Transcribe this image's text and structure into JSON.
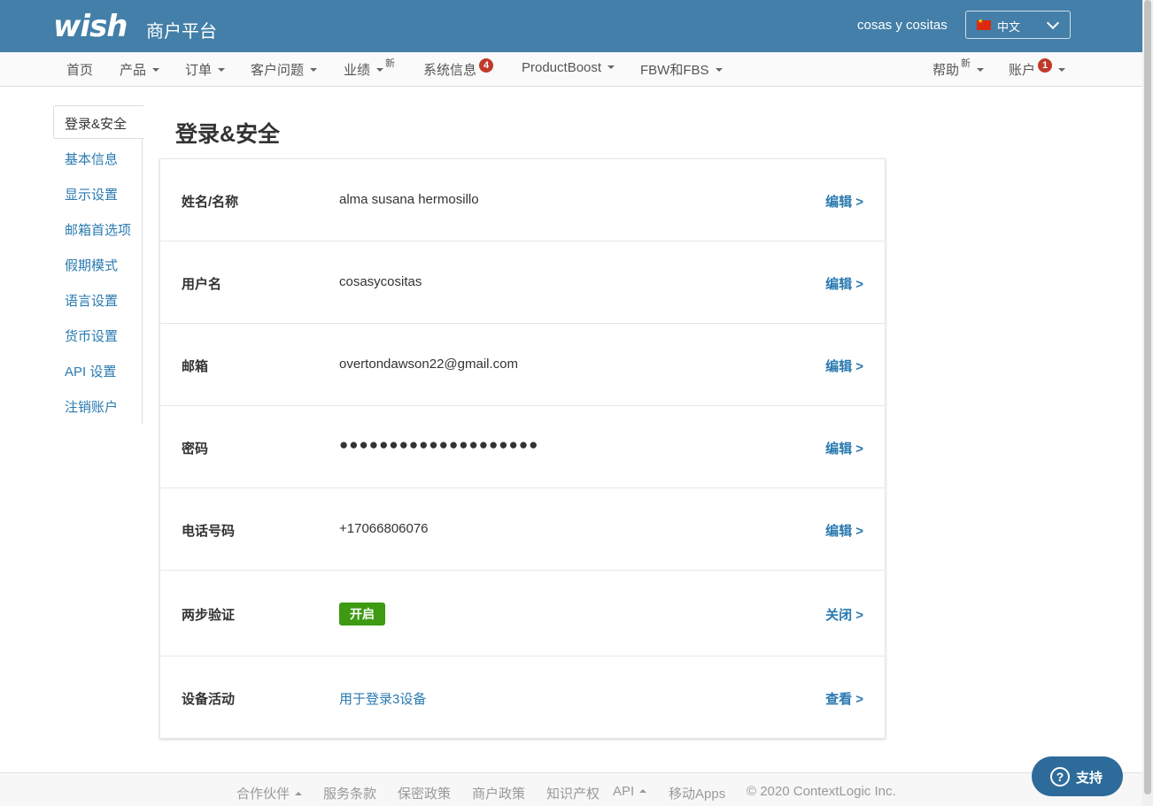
{
  "header": {
    "logo": "wish",
    "platform_title": "商户平台",
    "username": "cosas y cositas",
    "language": "中文"
  },
  "nav": {
    "home": "首页",
    "products": "产品",
    "orders": "订单",
    "customer_issues": "客户问题",
    "performance": "业绩",
    "performance_new": "新",
    "system_messages": "系统信息",
    "system_messages_badge": "4",
    "productboost": "ProductBoost",
    "fbw_fbs": "FBW和FBS",
    "help": "帮助",
    "help_new": "新",
    "account": "账户",
    "account_badge": "1"
  },
  "sidebar": {
    "active": "登录&安全",
    "items": [
      "基本信息",
      "显示设置",
      "邮箱首选项",
      "假期模式",
      "语言设置",
      "货币设置",
      "API 设置",
      "注销账户"
    ]
  },
  "page": {
    "title": "登录&安全"
  },
  "rows": [
    {
      "label": "姓名/名称",
      "value": "alma susana hermosillo",
      "action": "编辑 >"
    },
    {
      "label": "用户名",
      "value": "cosasycositas",
      "action": "编辑 >"
    },
    {
      "label": "邮箱",
      "value": "overtondawson22@gmail.com",
      "action": "编辑 >"
    },
    {
      "label": "密码",
      "value": "●●●●●●●●●●●●●●●●●●●●",
      "action": "编辑 >"
    },
    {
      "label": "电话号码",
      "value": "+17066806076",
      "action": "编辑 >"
    },
    {
      "label": "两步验证",
      "value": "开启",
      "action": "关闭 >"
    },
    {
      "label": "设备活动",
      "value": "用于登录3设备",
      "action": "查看 >"
    }
  ],
  "footer": {
    "partners": "合作伙伴",
    "terms": "服务条款",
    "privacy": "保密政策",
    "merchant_policy": "商户政策",
    "ip": "知识产权",
    "api": "API",
    "mobile": "移动Apps",
    "copyright": "© 2020 ContextLogic Inc."
  },
  "support": {
    "label": "支持"
  },
  "colors": {
    "header_bg": "#437fa8",
    "link": "#2a7ab0",
    "status_on": "#3d9a12",
    "badge": "#c0392b",
    "support_bg": "#2d6b9a"
  }
}
